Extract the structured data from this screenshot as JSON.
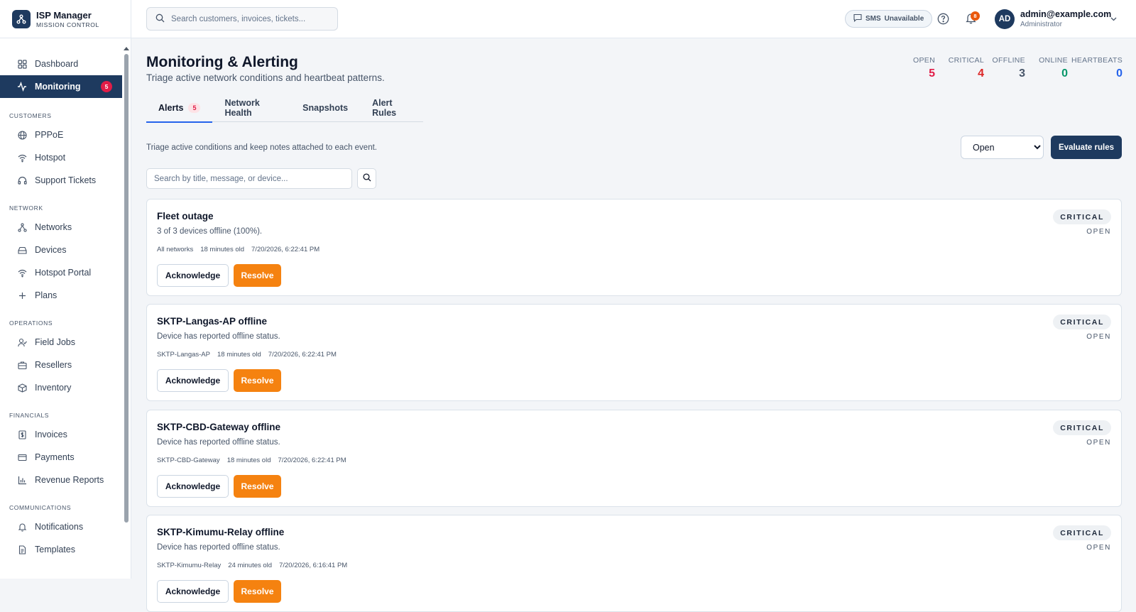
{
  "brand": {
    "title": "ISP Manager",
    "subtitle": "MISSION CONTROL"
  },
  "sidebar": {
    "top_items": [
      {
        "label": "Dashboard",
        "icon": "grid-icon"
      },
      {
        "label": "Monitoring",
        "icon": "activity-icon",
        "badge": "5",
        "active": true
      }
    ],
    "sections": [
      {
        "title": "CUSTOMERS",
        "items": [
          {
            "label": "PPPoE",
            "icon": "globe-icon"
          },
          {
            "label": "Hotspot",
            "icon": "wifi-icon"
          },
          {
            "label": "Support Tickets",
            "icon": "headset-icon"
          }
        ]
      },
      {
        "title": "NETWORK",
        "items": [
          {
            "label": "Networks",
            "icon": "network-icon"
          },
          {
            "label": "Devices",
            "icon": "hard-drive-icon"
          },
          {
            "label": "Hotspot Portal",
            "icon": "wifi-icon"
          },
          {
            "label": "Plans",
            "icon": "plus-icon"
          }
        ]
      },
      {
        "title": "OPERATIONS",
        "items": [
          {
            "label": "Field Jobs",
            "icon": "user-check-icon"
          },
          {
            "label": "Resellers",
            "icon": "briefcase-icon"
          },
          {
            "label": "Inventory",
            "icon": "package-icon"
          }
        ]
      },
      {
        "title": "FINANCIALS",
        "items": [
          {
            "label": "Invoices",
            "icon": "dollar-file-icon"
          },
          {
            "label": "Payments",
            "icon": "credit-card-icon"
          },
          {
            "label": "Revenue Reports",
            "icon": "bar-chart-icon"
          }
        ]
      },
      {
        "title": "COMMUNICATIONS",
        "items": [
          {
            "label": "Notifications",
            "icon": "bell-icon"
          },
          {
            "label": "Templates",
            "icon": "file-text-icon"
          }
        ]
      }
    ]
  },
  "topbar": {
    "search_placeholder": "Search customers, invoices, tickets...",
    "sms_prefix": "SMS",
    "sms_status": "Unavailable",
    "notification_count": "8",
    "avatar_initials": "AD",
    "user_email": "admin@example.com",
    "user_role": "Administrator"
  },
  "page": {
    "title": "Monitoring & Alerting",
    "subtitle": "Triage active network conditions and heartbeat patterns."
  },
  "stats": [
    {
      "label": "OPEN",
      "value": "5",
      "color": "#e11d48"
    },
    {
      "label": "CRITICAL",
      "value": "4",
      "color": "#dc2626"
    },
    {
      "label": "OFFLINE",
      "value": "3",
      "color": "#475569"
    },
    {
      "label": "ONLINE",
      "value": "0",
      "color": "#059669"
    },
    {
      "label": "HEARTBEATS",
      "value": "0",
      "color": "#2563eb"
    }
  ],
  "tabs": [
    {
      "label": "Alerts",
      "badge": "5",
      "active": true
    },
    {
      "label": "Network Health"
    },
    {
      "label": "Snapshots"
    },
    {
      "label": "Alert Rules"
    }
  ],
  "alerts_panel": {
    "hint": "Triage active conditions and keep notes attached to each event.",
    "status_options": [
      "Open"
    ],
    "status_selected": "Open",
    "evaluate_label": "Evaluate rules",
    "filter_placeholder": "Search by title, message, or device...",
    "acknowledge_label": "Acknowledge",
    "resolve_label": "Resolve"
  },
  "alerts": [
    {
      "title": "Fleet outage",
      "message": "3 of 3 devices offline (100%).",
      "source": "All networks",
      "age": "18 minutes old",
      "timestamp": "7/20/2026, 6:22:41 PM",
      "severity": "CRITICAL",
      "state": "OPEN"
    },
    {
      "title": "SKTP-Langas-AP offline",
      "message": "Device has reported offline status.",
      "source": "SKTP-Langas-AP",
      "age": "18 minutes old",
      "timestamp": "7/20/2026, 6:22:41 PM",
      "severity": "CRITICAL",
      "state": "OPEN"
    },
    {
      "title": "SKTP-CBD-Gateway offline",
      "message": "Device has reported offline status.",
      "source": "SKTP-CBD-Gateway",
      "age": "18 minutes old",
      "timestamp": "7/20/2026, 6:22:41 PM",
      "severity": "CRITICAL",
      "state": "OPEN"
    },
    {
      "title": "SKTP-Kimumu-Relay offline",
      "message": "Device has reported offline status.",
      "source": "SKTP-Kimumu-Relay",
      "age": "24 minutes old",
      "timestamp": "7/20/2026, 6:16:41 PM",
      "severity": "CRITICAL",
      "state": "OPEN"
    }
  ],
  "colors": {
    "brand_navy": "#1e3a5f",
    "accent_orange": "#f58210",
    "tab_underline": "#2563eb"
  }
}
